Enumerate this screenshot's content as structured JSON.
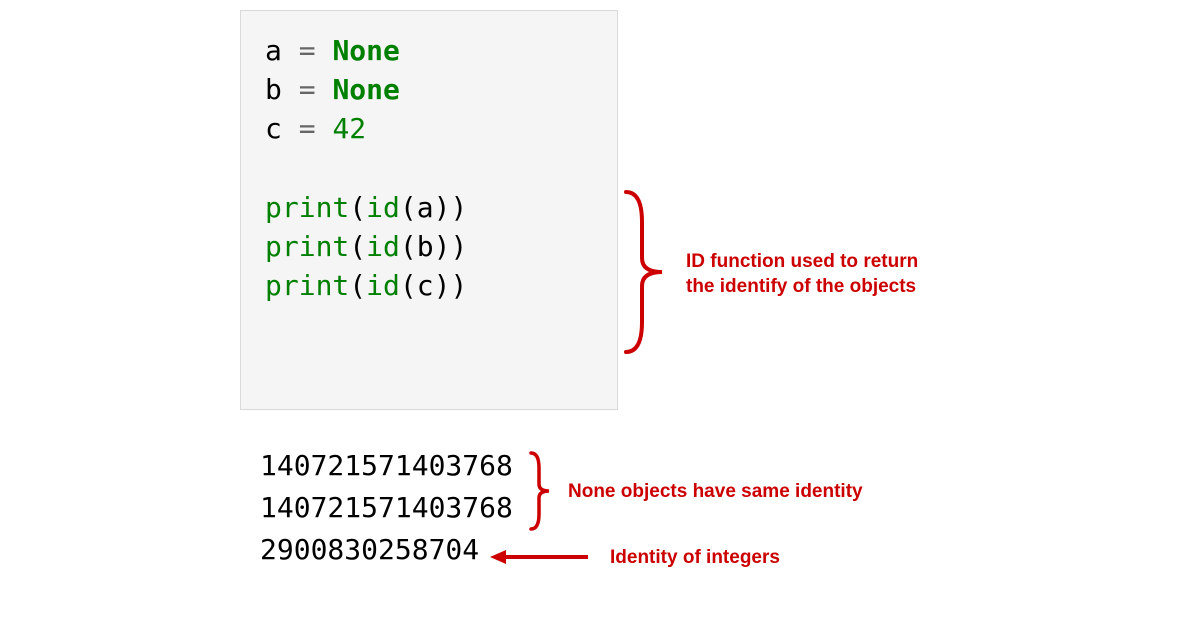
{
  "code": {
    "l1": {
      "var": "a",
      "op": " = ",
      "val": "None"
    },
    "l2": {
      "var": "b",
      "op": " = ",
      "val": "None"
    },
    "l3": {
      "var": "c",
      "op": " = ",
      "val": "42"
    },
    "l5": {
      "fn": "print",
      "p1": "(",
      "id": "id",
      "p2": "(",
      "arg": "a",
      "p3": "))"
    },
    "l6": {
      "fn": "print",
      "p1": "(",
      "id": "id",
      "p2": "(",
      "arg": "b",
      "p3": "))"
    },
    "l7": {
      "fn": "print",
      "p1": "(",
      "id": "id",
      "p2": "(",
      "arg": "c",
      "p3": "))"
    }
  },
  "output": {
    "o1": "140721571403768",
    "o2": "140721571403768",
    "o3": "2900830258704"
  },
  "annotations": {
    "a1_l1": "ID function used to return",
    "a1_l2": "the identify of the objects",
    "a2": "None objects have same identity",
    "a3": "Identity of integers"
  },
  "colors": {
    "annotation": "#cc0000",
    "keyword": "#008000"
  }
}
